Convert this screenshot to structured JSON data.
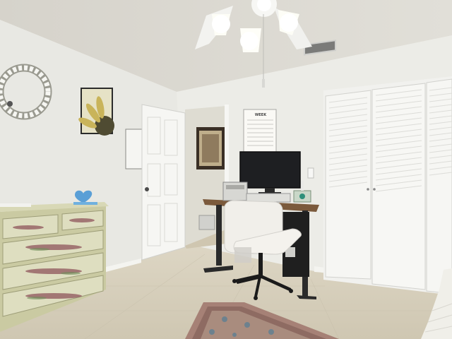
{
  "scene": {
    "palette": {
      "ceiling": "#d9d7cf",
      "wall_left": "#e9e9e4",
      "wall_back": "#ebebe6",
      "floor": "#d6d0bf",
      "dresser": "#cfcfa8",
      "closet": "#f4f4f1",
      "door": "#f6f6f3",
      "desk_top": "#7b5a3c",
      "chair": "#f1efea",
      "monitor": "#1e1f22",
      "rug": "#8e6b62"
    },
    "icons": {
      "ceiling_fan": "ceiling-fan-icon",
      "vent": "air-vent-icon",
      "wreath": "cotton-wreath-icon",
      "sunflower_art": "sunflower-art-icon",
      "monitor": "monitor-icon",
      "chair": "office-chair-icon"
    },
    "whiteboard": {
      "heading": "WEEK"
    }
  }
}
